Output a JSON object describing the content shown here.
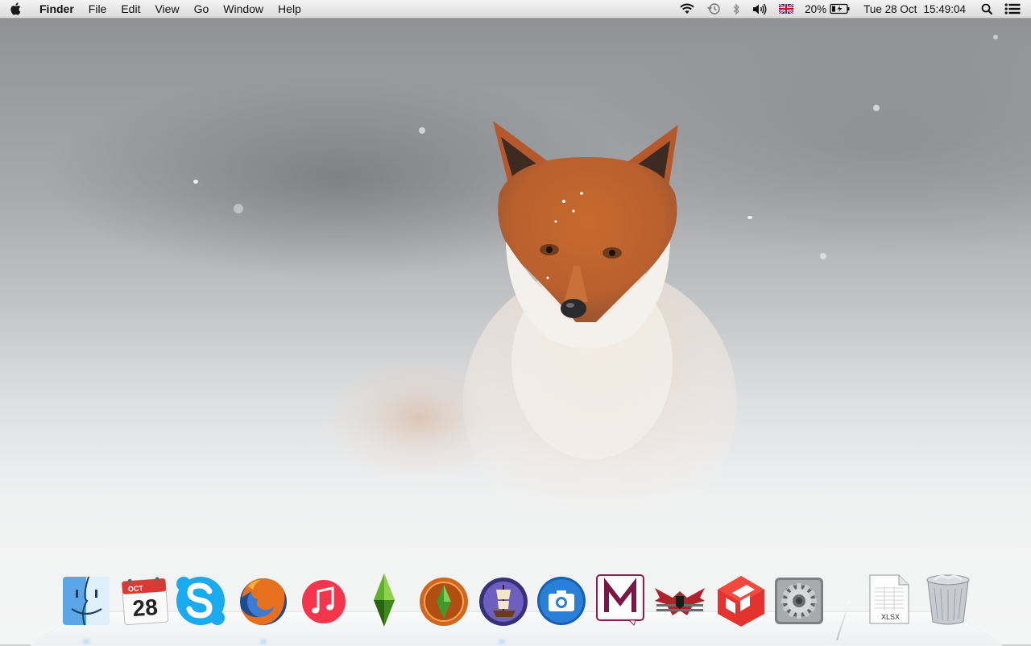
{
  "menubar": {
    "app_name": "Finder",
    "menus": [
      "File",
      "Edit",
      "View",
      "Go",
      "Window",
      "Help"
    ],
    "status": {
      "battery_percent": "20%",
      "date": "Tue 28 Oct",
      "time": "15:49:04"
    }
  },
  "dock": {
    "calendar": {
      "month": "OCT",
      "day": "28"
    },
    "document_icon_label": "XLSX",
    "items": [
      {
        "name": "finder",
        "icon": "finder-icon"
      },
      {
        "name": "calendar",
        "icon": "calendar-icon"
      },
      {
        "name": "skype",
        "icon": "skype-icon"
      },
      {
        "name": "firefox",
        "icon": "firefox-icon"
      },
      {
        "name": "itunes",
        "icon": "itunes-icon"
      },
      {
        "name": "the-sims",
        "icon": "plumbob-icon"
      },
      {
        "name": "sims-medieval",
        "icon": "plumbob-medallion-icon"
      },
      {
        "name": "ship-game",
        "icon": "ship-icon"
      },
      {
        "name": "screenshot",
        "icon": "camera-icon"
      },
      {
        "name": "m-app",
        "icon": "m-letter-icon"
      },
      {
        "name": "papers-please",
        "icon": "eagle-emblem-icon"
      },
      {
        "name": "sketchup",
        "icon": "sketchup-icon"
      },
      {
        "name": "system-preferences",
        "icon": "gear-icon"
      },
      {
        "name": "xlsx-document",
        "icon": "spreadsheet-document-icon"
      },
      {
        "name": "trash",
        "icon": "trash-icon"
      }
    ]
  },
  "colors": {
    "menubar_bg": "#e6e6e6",
    "skype_blue": "#1aaaf0",
    "itunes_red": "#f6344c",
    "sketchup_red": "#e4322e"
  }
}
